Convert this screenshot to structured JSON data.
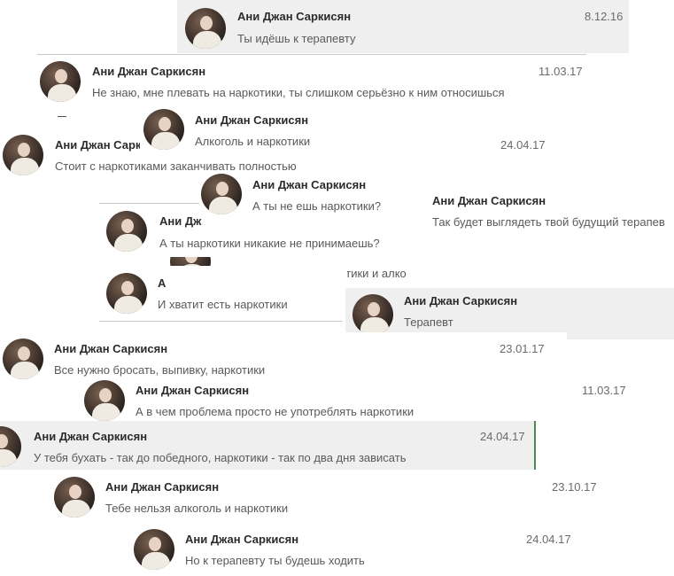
{
  "messages": [
    {
      "name": "Ани Джан Саркисян",
      "date": "8.12.16",
      "text": "Ты идёшь к терапевту"
    },
    {
      "name": "Ани Джан Саркисян",
      "date": "11.03.17",
      "text": "Не знаю, мне плевать на наркотики, ты слишком серьёзно к ним относишься"
    },
    {
      "name": "Ани Джан Саркисян",
      "date": "",
      "text": "Алкоголь и наркотики"
    },
    {
      "name": "Ани Джан Сарк",
      "date": "24.04.17",
      "text": "Стоит с наркотиками заканчивать полностью"
    },
    {
      "name": "Ани Джан Саркисян",
      "date": "",
      "text": "А ты не ешь наркотики?"
    },
    {
      "name": "Ани Джан Саркисян",
      "date": "",
      "text": "Так будет выглядеть твой будущий терапев"
    },
    {
      "name": "Ани Дж",
      "date": "",
      "text": "А ты наркотики никакие не принимаешь?"
    },
    {
      "name": "",
      "date": "",
      "text": "И хватит мешать наркотики и алко"
    },
    {
      "name": "А",
      "date": "",
      "text": "И хватит есть наркотики"
    },
    {
      "name": "Ани Джан Саркисян",
      "date": "",
      "text": "Терапевт"
    },
    {
      "name": "Ани Джан Саркисян",
      "date": "23.01.17",
      "text": "Все нужно бросать, выпивку, наркотики"
    },
    {
      "name": "Ани Джан Саркисян",
      "date": "11.03.17",
      "text": "А в чем проблема просто не употреблять наркотики"
    },
    {
      "name": "Ани Джан Саркисян",
      "date": "24.04.17",
      "text": "У тебя бухать - так до победного, наркотики - так по два дня зависать"
    },
    {
      "name": "Ани Джан Саркисян",
      "date": "23.10.17",
      "text": "Тебе нельзя алкоголь и наркотики"
    },
    {
      "name": "Ани Джан Саркисян",
      "date": "24.04.17",
      "text": "Но к терапевту ты будешь ходить"
    }
  ]
}
